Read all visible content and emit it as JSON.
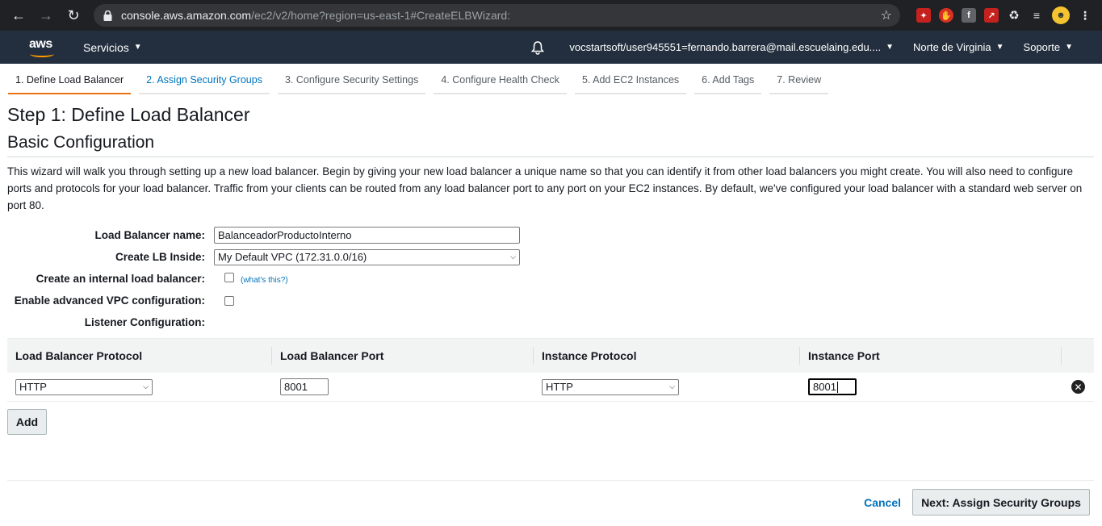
{
  "browser": {
    "url_host": "console.aws.amazon.com",
    "url_rest": "/ec2/v2/home?region=us-east-1#CreateELBWizard:"
  },
  "aws_header": {
    "logo": "aws",
    "services": "Servicios",
    "account": "vocstartsoft/user945551=fernando.barrera@mail.escuelaing.edu....",
    "region": "Norte de Virginia",
    "support": "Soporte"
  },
  "steps": [
    {
      "label": "1. Define Load Balancer",
      "state": "active"
    },
    {
      "label": "2. Assign Security Groups",
      "state": "link"
    },
    {
      "label": "3. Configure Security Settings",
      "state": "disabled"
    },
    {
      "label": "4. Configure Health Check",
      "state": "disabled"
    },
    {
      "label": "5. Add EC2 Instances",
      "state": "disabled"
    },
    {
      "label": "6. Add Tags",
      "state": "disabled"
    },
    {
      "label": "7. Review",
      "state": "disabled"
    }
  ],
  "page": {
    "title": "Step 1: Define Load Balancer",
    "section": "Basic Configuration",
    "description": "This wizard will walk you through setting up a new load balancer. Begin by giving your new load balancer a unique name so that you can identify it from other load balancers you might create. You will also need to configure ports and protocols for your load balancer. Traffic from your clients can be routed from any load balancer port to any port on your EC2 instances. By default, we've configured your load balancer with a standard web server on port 80."
  },
  "form": {
    "lb_name_label": "Load Balancer name:",
    "lb_name_value": "BalanceadorProductoInterno",
    "create_inside_label": "Create LB Inside:",
    "create_inside_value": "My Default VPC (172.31.0.0/16)",
    "internal_label": "Create an internal load balancer:",
    "internal_help": "(what's this?)",
    "advanced_vpc_label": "Enable advanced VPC configuration:",
    "listener_label": "Listener Configuration:"
  },
  "listener": {
    "headers": [
      "Load Balancer Protocol",
      "Load Balancer Port",
      "Instance Protocol",
      "Instance Port"
    ],
    "row": {
      "lb_protocol": "HTTP",
      "lb_port": "8001",
      "instance_protocol": "HTTP",
      "instance_port": "8001"
    },
    "add_label": "Add"
  },
  "footer": {
    "cancel": "Cancel",
    "next": "Next: Assign Security Groups"
  }
}
